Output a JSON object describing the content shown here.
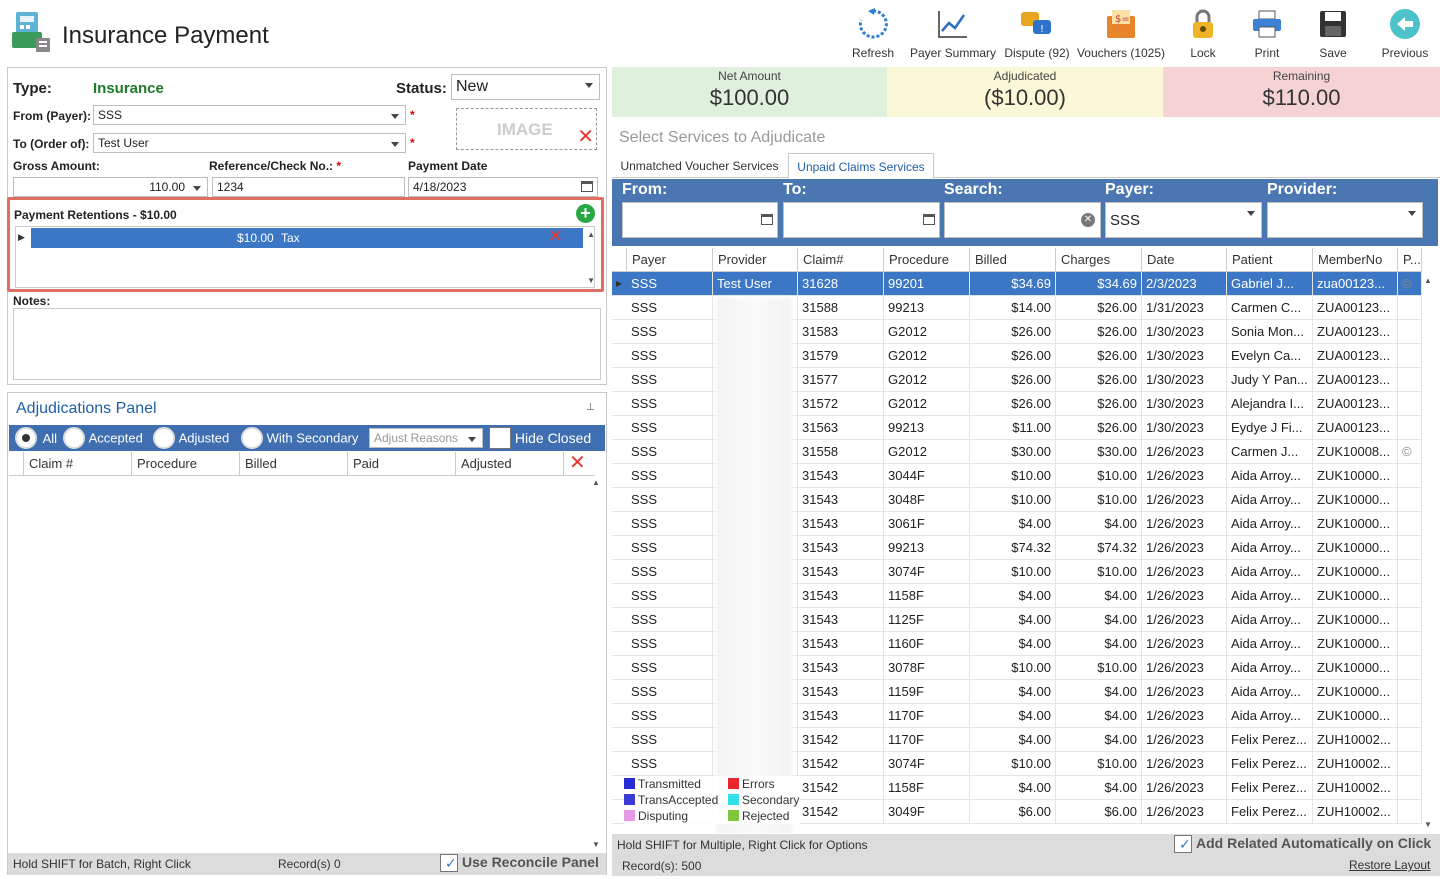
{
  "window": {
    "title": "Insurance Payment"
  },
  "toolbar": [
    {
      "label": "Refresh",
      "icon": "refresh-icon"
    },
    {
      "label": "Payer Summary",
      "icon": "chart-icon"
    },
    {
      "label": "Dispute (92)",
      "icon": "dispute-icon"
    },
    {
      "label": "Vouchers (1025)",
      "icon": "vouchers-icon"
    },
    {
      "label": "Lock",
      "icon": "lock-icon"
    },
    {
      "label": "Print",
      "icon": "print-icon"
    },
    {
      "label": "Save",
      "icon": "save-icon"
    },
    {
      "label": "Previous",
      "icon": "previous-icon"
    }
  ],
  "form": {
    "type_label": "Type:",
    "type_value": "Insurance",
    "status_label": "Status:",
    "status_value": "New",
    "from_label": "From (Payer):",
    "from_value": "SSS",
    "to_label": "To (Order of):",
    "to_value": "Test User",
    "image_label": "IMAGE",
    "gross_label": "Gross Amount:",
    "gross_value": "110.00",
    "ref_label": "Reference/Check No.:",
    "ref_value": "1234",
    "date_label": "Payment Date",
    "date_value": "4/18/2023",
    "retentions_label": "Payment Retentions - $10.00",
    "retention_row": {
      "amount": "$10.00",
      "type": "Tax"
    },
    "notes_label": "Notes:"
  },
  "adjudications": {
    "title": "Adjudications Panel",
    "filters": [
      "All",
      "Accepted",
      "Adjusted",
      "With Secondary"
    ],
    "reasons_placeholder": "Adjust Reasons",
    "hide_closed": "Hide Closed",
    "columns": [
      "Claim #",
      "Procedure",
      "Billed",
      "Paid",
      "Adjusted"
    ],
    "status_left": "Hold SHIFT for Batch, Right Click",
    "records": "Record(s) 0",
    "use_reconcile": "Use Reconcile Panel"
  },
  "summary": {
    "net_label": "Net Amount",
    "net_value": "$100.00",
    "adj_label": "Adjudicated",
    "adj_value": "($10.00)",
    "rem_label": "Remaining",
    "rem_value": "$110.00",
    "colors": {
      "net": "#dff0dc",
      "adj": "#fbf8d8",
      "rem": "#f6d3d3"
    }
  },
  "services": {
    "title": "Select Services to Adjudicate",
    "tabs": [
      "Unmatched Voucher Services",
      "Unpaid Claims Services"
    ],
    "filters": {
      "from": "From:",
      "to": "To:",
      "search": "Search:",
      "payer": "Payer:",
      "payer_value": "SSS",
      "provider": "Provider:"
    },
    "columns": [
      "Payer",
      "Provider",
      "Claim#",
      "Procedure",
      "Billed",
      "Charges",
      "Date",
      "Patient",
      "MemberNo",
      "P..."
    ],
    "rows": [
      [
        "SSS",
        "Test User",
        "31628",
        "99201",
        "$34.69",
        "$34.69",
        "2/3/2023",
        "Gabriel J...",
        "zua00123..."
      ],
      [
        "SSS",
        "",
        "31588",
        "99213",
        "$14.00",
        "$26.00",
        "1/31/2023",
        "Carmen C...",
        "ZUA00123..."
      ],
      [
        "SSS",
        "",
        "31583",
        "G2012",
        "$26.00",
        "$26.00",
        "1/30/2023",
        "Sonia Mon...",
        "ZUA00123..."
      ],
      [
        "SSS",
        "",
        "31579",
        "G2012",
        "$26.00",
        "$26.00",
        "1/30/2023",
        "Evelyn Ca...",
        "ZUA00123..."
      ],
      [
        "SSS",
        "",
        "31577",
        "G2012",
        "$26.00",
        "$26.00",
        "1/30/2023",
        "Judy Y Pan...",
        "ZUA00123..."
      ],
      [
        "SSS",
        "",
        "31572",
        "G2012",
        "$26.00",
        "$26.00",
        "1/30/2023",
        "Alejandra I...",
        "ZUA00123..."
      ],
      [
        "SSS",
        "",
        "31563",
        "99213",
        "$11.00",
        "$26.00",
        "1/30/2023",
        "Eydye J Fi...",
        "ZUA00123..."
      ],
      [
        "SSS",
        "",
        "31558",
        "G2012",
        "$30.00",
        "$30.00",
        "1/26/2023",
        "Carmen J...",
        "ZUK10008..."
      ],
      [
        "SSS",
        "",
        "31543",
        "3044F",
        "$10.00",
        "$10.00",
        "1/26/2023",
        "Aida Arroy...",
        "ZUK10000..."
      ],
      [
        "SSS",
        "",
        "31543",
        "3048F",
        "$10.00",
        "$10.00",
        "1/26/2023",
        "Aida Arroy...",
        "ZUK10000..."
      ],
      [
        "SSS",
        "",
        "31543",
        "3061F",
        "$4.00",
        "$4.00",
        "1/26/2023",
        "Aida Arroy...",
        "ZUK10000..."
      ],
      [
        "SSS",
        "",
        "31543",
        "99213",
        "$74.32",
        "$74.32",
        "1/26/2023",
        "Aida Arroy...",
        "ZUK10000..."
      ],
      [
        "SSS",
        "",
        "31543",
        "3074F",
        "$10.00",
        "$10.00",
        "1/26/2023",
        "Aida Arroy...",
        "ZUK10000..."
      ],
      [
        "SSS",
        "",
        "31543",
        "1158F",
        "$4.00",
        "$4.00",
        "1/26/2023",
        "Aida Arroy...",
        "ZUK10000..."
      ],
      [
        "SSS",
        "",
        "31543",
        "1125F",
        "$4.00",
        "$4.00",
        "1/26/2023",
        "Aida Arroy...",
        "ZUK10000..."
      ],
      [
        "SSS",
        "",
        "31543",
        "1160F",
        "$4.00",
        "$4.00",
        "1/26/2023",
        "Aida Arroy...",
        "ZUK10000..."
      ],
      [
        "SSS",
        "",
        "31543",
        "3078F",
        "$10.00",
        "$10.00",
        "1/26/2023",
        "Aida Arroy...",
        "ZUK10000..."
      ],
      [
        "SSS",
        "",
        "31543",
        "1159F",
        "$4.00",
        "$4.00",
        "1/26/2023",
        "Aida Arroy...",
        "ZUK10000..."
      ],
      [
        "SSS",
        "",
        "31543",
        "1170F",
        "$4.00",
        "$4.00",
        "1/26/2023",
        "Aida Arroy...",
        "ZUK10000..."
      ],
      [
        "SSS",
        "",
        "31542",
        "1170F",
        "$4.00",
        "$4.00",
        "1/26/2023",
        "Felix Perez...",
        "ZUH10002..."
      ],
      [
        "SSS",
        "",
        "31542",
        "3074F",
        "$10.00",
        "$10.00",
        "1/26/2023",
        "Felix Perez...",
        "ZUH10002..."
      ],
      [
        "",
        "",
        "31542",
        "1158F",
        "$4.00",
        "$4.00",
        "1/26/2023",
        "Felix Perez...",
        "ZUH10002..."
      ],
      [
        "",
        "",
        "31542",
        "3049F",
        "$6.00",
        "$6.00",
        "1/26/2023",
        "Felix Perez...",
        "ZUH10002..."
      ]
    ],
    "legend": [
      {
        "label": "Transmitted",
        "color": "#2b2bd6"
      },
      {
        "label": "Errors",
        "color": "#e8262b"
      },
      {
        "label": "TransAccepted",
        "color": "#3a3ad9"
      },
      {
        "label": "Secondary",
        "color": "#33e0e8"
      },
      {
        "label": "Disputing",
        "color": "#e69ae6"
      },
      {
        "label": "Rejected",
        "color": "#7fc63a"
      }
    ],
    "status_left": "Hold SHIFT for Multiple, Right Click for Options",
    "records": "Record(s): 500",
    "add_related": "Add Related Automatically on Click",
    "restore_layout": "Restore Layout"
  }
}
